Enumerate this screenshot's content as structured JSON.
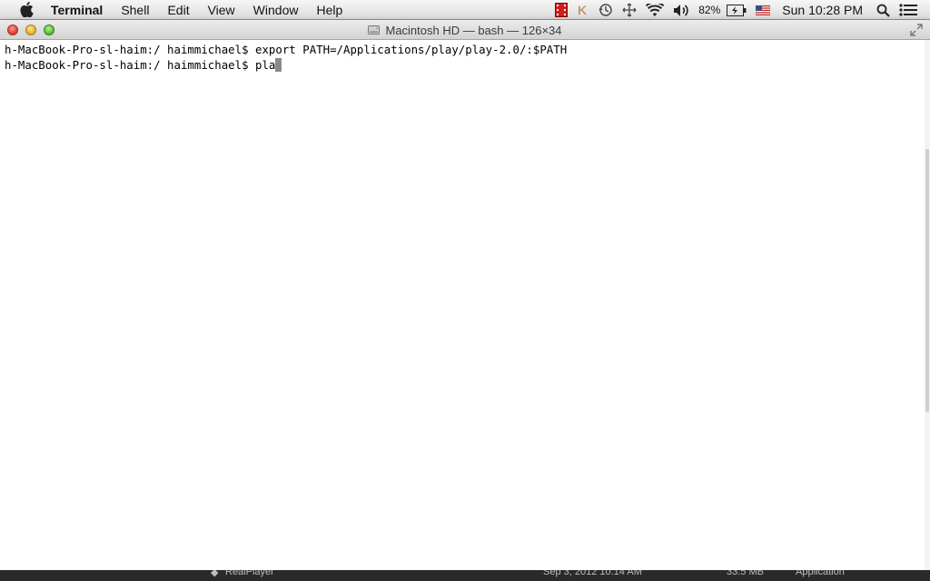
{
  "menubar": {
    "app_name": "Terminal",
    "items": [
      "Shell",
      "Edit",
      "View",
      "Window",
      "Help"
    ],
    "status": {
      "battery_percent": "82%",
      "clock": "Sun 10:28 PM"
    }
  },
  "window": {
    "title": "Macintosh HD — bash — 126×34"
  },
  "terminal": {
    "lines": [
      "h-MacBook-Pro-sl-haim:/ haimmichael$ export PATH=/Applications/play/play-2.0/:$PATH",
      "h-MacBook-Pro-sl-haim:/ haimmichael$ pla"
    ]
  },
  "background_window": {
    "cells": [
      "RealPlayer",
      "Sep 3, 2012 10:14 AM",
      "33.5 MB",
      "Application"
    ]
  },
  "colors": {
    "accent_close": "#e0443a",
    "accent_minimize": "#e7b53a",
    "accent_maximize": "#5fbf3a"
  }
}
